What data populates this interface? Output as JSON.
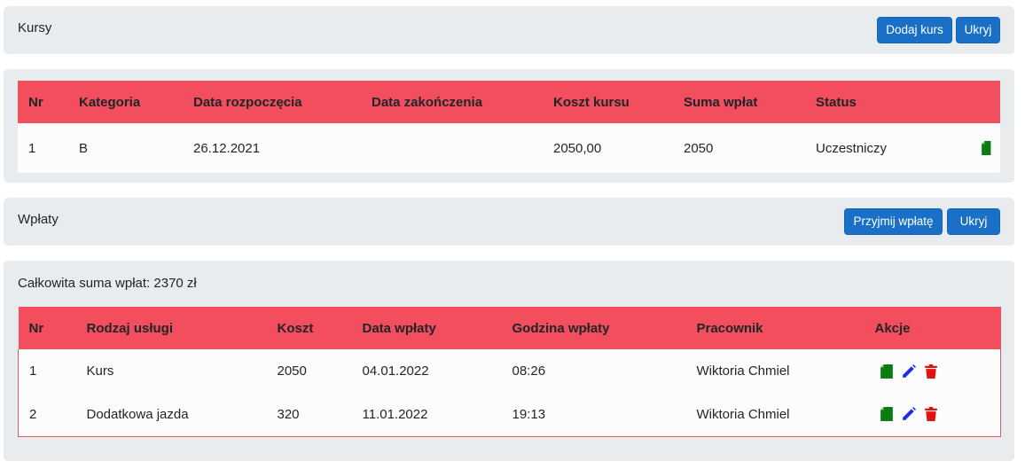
{
  "courses_panel": {
    "title": "Kursy",
    "add_button": "Dodaj kurs",
    "hide_button": "Ukryj"
  },
  "courses_table": {
    "headers": [
      "Nr",
      "Kategoria",
      "Data rozpoczęcia",
      "Data zakończenia",
      "Koszt kursu",
      "Suma wpłat",
      "Status",
      ""
    ],
    "rows": [
      {
        "nr": "1",
        "category": "B",
        "start": "26.12.2021",
        "end": "",
        "cost": "2050,00",
        "paid": "2050",
        "status": "Uczestniczy"
      }
    ]
  },
  "payments_panel": {
    "title": "Wpłaty",
    "accept_button": "Przyjmij wpłatę",
    "hide_button": "Ukryj"
  },
  "payments_summary": "Całkowita suma wpłat: 2370 zł",
  "payments_table": {
    "headers": [
      "Nr",
      "Rodzaj usługi",
      "Koszt",
      "Data wpłaty",
      "Godzina wpłaty",
      "Pracownik",
      "Akcje"
    ],
    "rows": [
      {
        "nr": "1",
        "service": "Kurs",
        "cost": "2050",
        "date": "04.01.2022",
        "time": "08:26",
        "employee": "Wiktoria Chmiel"
      },
      {
        "nr": "2",
        "service": "Dodatkowa jazda",
        "cost": "320",
        "date": "11.01.2022",
        "time": "19:13",
        "employee": "Wiktoria Chmiel"
      }
    ]
  },
  "icons": {
    "details": "document-icon",
    "edit": "pencil-icon",
    "delete": "trash-icon"
  },
  "colors": {
    "panel_bg": "#e9ecef",
    "header_bg": "#f24e5d",
    "button_bg": "#1a6fc7",
    "icon_green": "#0a7d12",
    "icon_blue": "#1f2fe8",
    "icon_red": "#e31212"
  }
}
